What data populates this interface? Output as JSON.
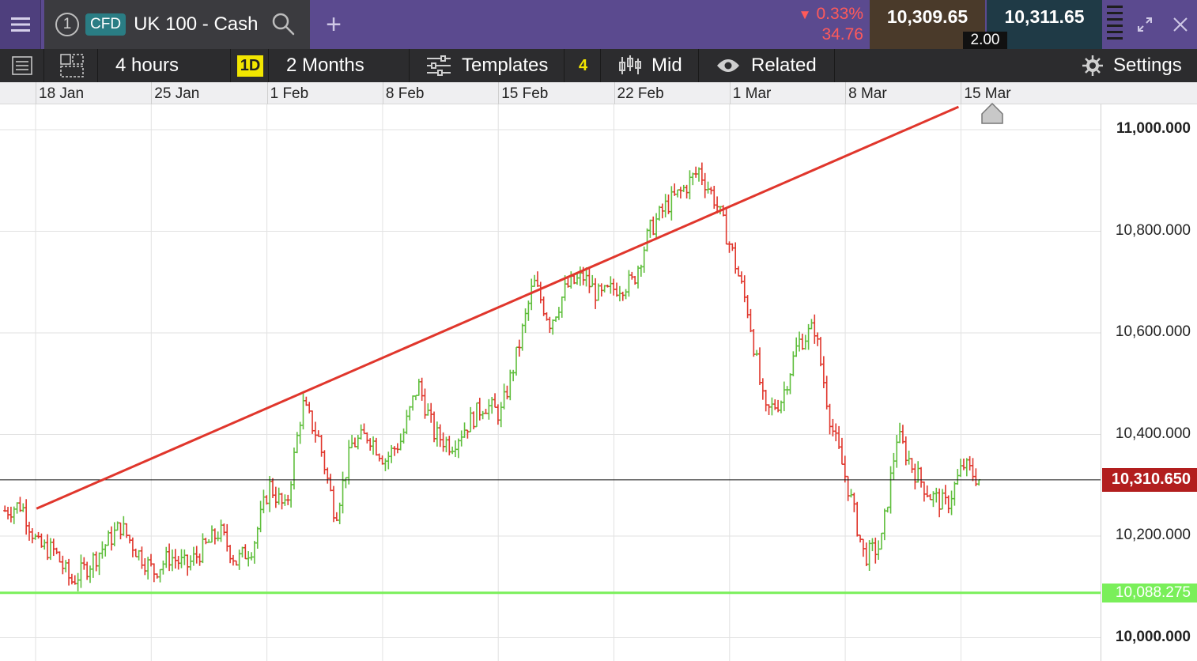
{
  "header": {
    "instrument_number": "1",
    "instrument_type": "CFD",
    "instrument_name": "UK 100 - Cash",
    "add_tab": "+",
    "change_pct": "0.33%",
    "change_abs": "34.76",
    "sell_price": "10,309.65",
    "buy_price": "10,311.65",
    "spread": "2.00",
    "colors": {
      "bar": "#5b4a8f",
      "negative": "#ff5a5a",
      "sell_bg": "#4a3a2a",
      "buy_bg": "#1f3a46"
    }
  },
  "toolbar": {
    "interval": "4 hours",
    "period_badge": "1D",
    "range": "2 Months",
    "templates": "Templates",
    "templates_count": "4",
    "price_type": "Mid",
    "related": "Related",
    "settings": "Settings"
  },
  "date_axis": {
    "labels": [
      "18 Jan",
      "25 Jan",
      "1 Feb",
      "8 Feb",
      "15 Feb",
      "22 Feb",
      "1 Mar",
      "8 Mar",
      "15 Mar"
    ]
  },
  "chart_data": {
    "type": "ohlc",
    "symbol": "UK 100 - Cash",
    "interval": "4 hours",
    "range": "2 Months",
    "y_tick_labels": [
      "11,000.000",
      "10,800.000",
      "10,600.000",
      "10,400.000",
      "10,200.000",
      "10,000.000"
    ],
    "y_ticks": [
      11000,
      10800,
      10600,
      10400,
      10200,
      10000
    ],
    "ylim": [
      9955,
      11050
    ],
    "x_start": "2023-01-18",
    "x_end": "2023-03-17",
    "grid": true,
    "up_color": "#5fbe3c",
    "down_color": "#e0362c",
    "last_price": {
      "value": 10310.65,
      "label": "10,310.650",
      "color": "#b21e1e"
    },
    "horizontal_line": {
      "value": 10088.275,
      "label": "10,088.275",
      "color": "#7aef5a"
    },
    "trendline": {
      "color": "#e0362c",
      "points": [
        {
          "date": "2023-01-16",
          "value": 10254
        },
        {
          "date": "2023-03-15",
          "value": 11045
        }
      ]
    },
    "price_path": [
      {
        "date": "2023-01-16",
        "value": 10250
      },
      {
        "date": "2023-01-17",
        "value": 10262
      },
      {
        "date": "2023-01-18",
        "value": 10180
      },
      {
        "date": "2023-01-19",
        "value": 10170
      },
      {
        "date": "2023-01-20",
        "value": 10110
      },
      {
        "date": "2023-01-21",
        "value": 10140
      },
      {
        "date": "2023-01-23",
        "value": 10220
      },
      {
        "date": "2023-01-24",
        "value": 10170
      },
      {
        "date": "2023-01-25",
        "value": 10130
      },
      {
        "date": "2023-01-26",
        "value": 10160
      },
      {
        "date": "2023-01-27",
        "value": 10140
      },
      {
        "date": "2023-01-29",
        "value": 10210
      },
      {
        "date": "2023-01-30",
        "value": 10150
      },
      {
        "date": "2023-01-31",
        "value": 10180
      },
      {
        "date": "2023-02-01",
        "value": 10300
      },
      {
        "date": "2023-02-02",
        "value": 10250
      },
      {
        "date": "2023-02-03",
        "value": 10460
      },
      {
        "date": "2023-02-04",
        "value": 10390
      },
      {
        "date": "2023-02-05",
        "value": 10240
      },
      {
        "date": "2023-02-06",
        "value": 10380
      },
      {
        "date": "2023-02-07",
        "value": 10400
      },
      {
        "date": "2023-02-08",
        "value": 10350
      },
      {
        "date": "2023-02-09",
        "value": 10390
      },
      {
        "date": "2023-02-10",
        "value": 10500
      },
      {
        "date": "2023-02-11",
        "value": 10400
      },
      {
        "date": "2023-02-12",
        "value": 10380
      },
      {
        "date": "2023-02-13",
        "value": 10420
      },
      {
        "date": "2023-02-14",
        "value": 10460
      },
      {
        "date": "2023-02-15",
        "value": 10440
      },
      {
        "date": "2023-02-16",
        "value": 10560
      },
      {
        "date": "2023-02-17",
        "value": 10700
      },
      {
        "date": "2023-02-18",
        "value": 10620
      },
      {
        "date": "2023-02-19",
        "value": 10690
      },
      {
        "date": "2023-02-20",
        "value": 10710
      },
      {
        "date": "2023-02-21",
        "value": 10670
      },
      {
        "date": "2023-02-22",
        "value": 10690
      },
      {
        "date": "2023-02-23",
        "value": 10700
      },
      {
        "date": "2023-02-24",
        "value": 10800
      },
      {
        "date": "2023-02-25",
        "value": 10850
      },
      {
        "date": "2023-02-26",
        "value": 10880
      },
      {
        "date": "2023-02-27",
        "value": 10920
      },
      {
        "date": "2023-02-28",
        "value": 10860
      },
      {
        "date": "2023-03-01",
        "value": 10760
      },
      {
        "date": "2023-03-02",
        "value": 10640
      },
      {
        "date": "2023-03-03",
        "value": 10440
      },
      {
        "date": "2023-03-04",
        "value": 10470
      },
      {
        "date": "2023-03-05",
        "value": 10580
      },
      {
        "date": "2023-03-06",
        "value": 10610
      },
      {
        "date": "2023-03-07",
        "value": 10420
      },
      {
        "date": "2023-03-08",
        "value": 10300
      },
      {
        "date": "2023-03-09",
        "value": 10160
      },
      {
        "date": "2023-03-10",
        "value": 10180
      },
      {
        "date": "2023-03-11",
        "value": 10400
      },
      {
        "date": "2023-03-12",
        "value": 10330
      },
      {
        "date": "2023-03-13",
        "value": 10280
      },
      {
        "date": "2023-03-14",
        "value": 10260
      },
      {
        "date": "2023-03-15",
        "value": 10340
      },
      {
        "date": "2023-03-16",
        "value": 10310
      }
    ]
  }
}
